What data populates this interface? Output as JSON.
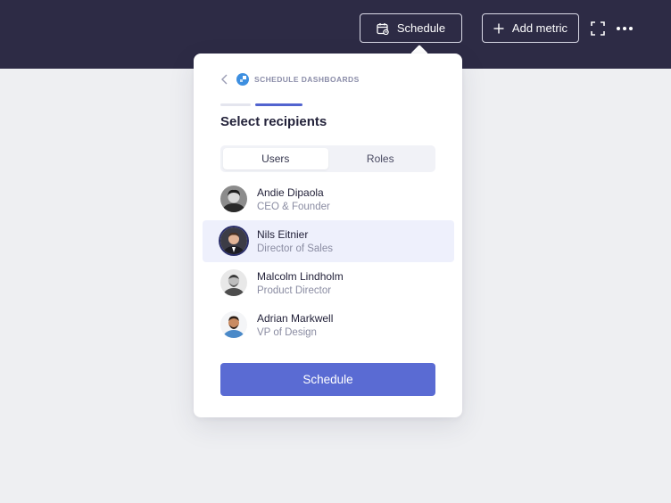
{
  "topbar": {
    "schedule_label": "Schedule",
    "add_metric_label": "Add metric",
    "icons": [
      "calendar-icon",
      "plus-icon",
      "expand-icon",
      "more-icon"
    ],
    "background_color": "#2d2b45"
  },
  "popover": {
    "breadcrumb": "SCHEDULE DASHBOARDS",
    "title": "Select recipients",
    "steps": {
      "total": 2,
      "current": 2
    },
    "tabs": [
      {
        "label": "Users",
        "active": true
      },
      {
        "label": "Roles",
        "active": false
      }
    ],
    "recipients": [
      {
        "name": "Andie Dipaola",
        "role": "CEO & Founder",
        "selected": false
      },
      {
        "name": "Nils Eitnier",
        "role": "Director of Sales",
        "selected": true
      },
      {
        "name": "Malcolm Lindholm",
        "role": "Product Director",
        "selected": false
      },
      {
        "name": "Adrian Markwell",
        "role": "VP of Design",
        "selected": false
      }
    ],
    "primary_button": "Schedule",
    "accent_color": "#5a6bd3"
  }
}
